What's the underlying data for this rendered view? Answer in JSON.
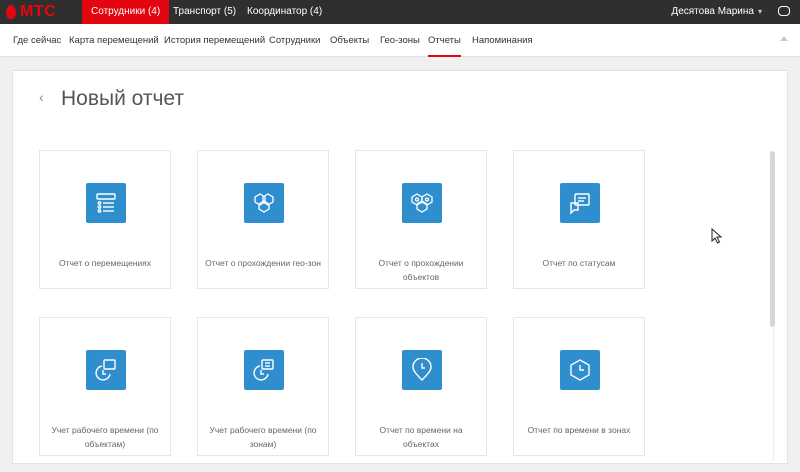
{
  "brand": {
    "name": "МТС",
    "color": "#e30611"
  },
  "topbar": {
    "tabs": [
      {
        "label": "Сотрудники (4)"
      },
      {
        "label": "Транспорт (5)"
      },
      {
        "label": "Координатор (4)"
      }
    ],
    "user": "Десятова Марина",
    "chat_icon": "chat-icon"
  },
  "subnav": {
    "items": [
      {
        "label": "Где сейчас"
      },
      {
        "label": "Карта перемещений"
      },
      {
        "label": "История перемещений"
      },
      {
        "label": "Сотрудники"
      },
      {
        "label": "Объекты"
      },
      {
        "label": "Гео-зоны"
      },
      {
        "label": "Отчеты"
      },
      {
        "label": "Напоминания"
      }
    ],
    "active": "Отчеты"
  },
  "page": {
    "back_icon": "chevron-left-icon",
    "title": "Новый отчет"
  },
  "reports": [
    {
      "label": "Отчет о перемещениях",
      "icon": "route-list-icon"
    },
    {
      "label": "Отчет о прохождении гео-зон",
      "icon": "geozones-icon"
    },
    {
      "label": "Отчет о прохождении объектов",
      "icon": "objects-icon"
    },
    {
      "label": "Отчет по статусам",
      "icon": "status-chat-icon"
    },
    {
      "label": "Учет рабочего времени (по объектам)",
      "icon": "worktime-objects-icon"
    },
    {
      "label": "Учет рабочего времени (по зонам)",
      "icon": "worktime-zones-icon"
    },
    {
      "label": "Отчет по времени на объектах",
      "icon": "clock-pin-icon"
    },
    {
      "label": "Отчет по времени в зонах",
      "icon": "clock-hexagon-icon"
    }
  ],
  "colors": {
    "accent": "#e30611",
    "icon_bg": "#2f8fce",
    "topbar": "#2f2f2f"
  }
}
